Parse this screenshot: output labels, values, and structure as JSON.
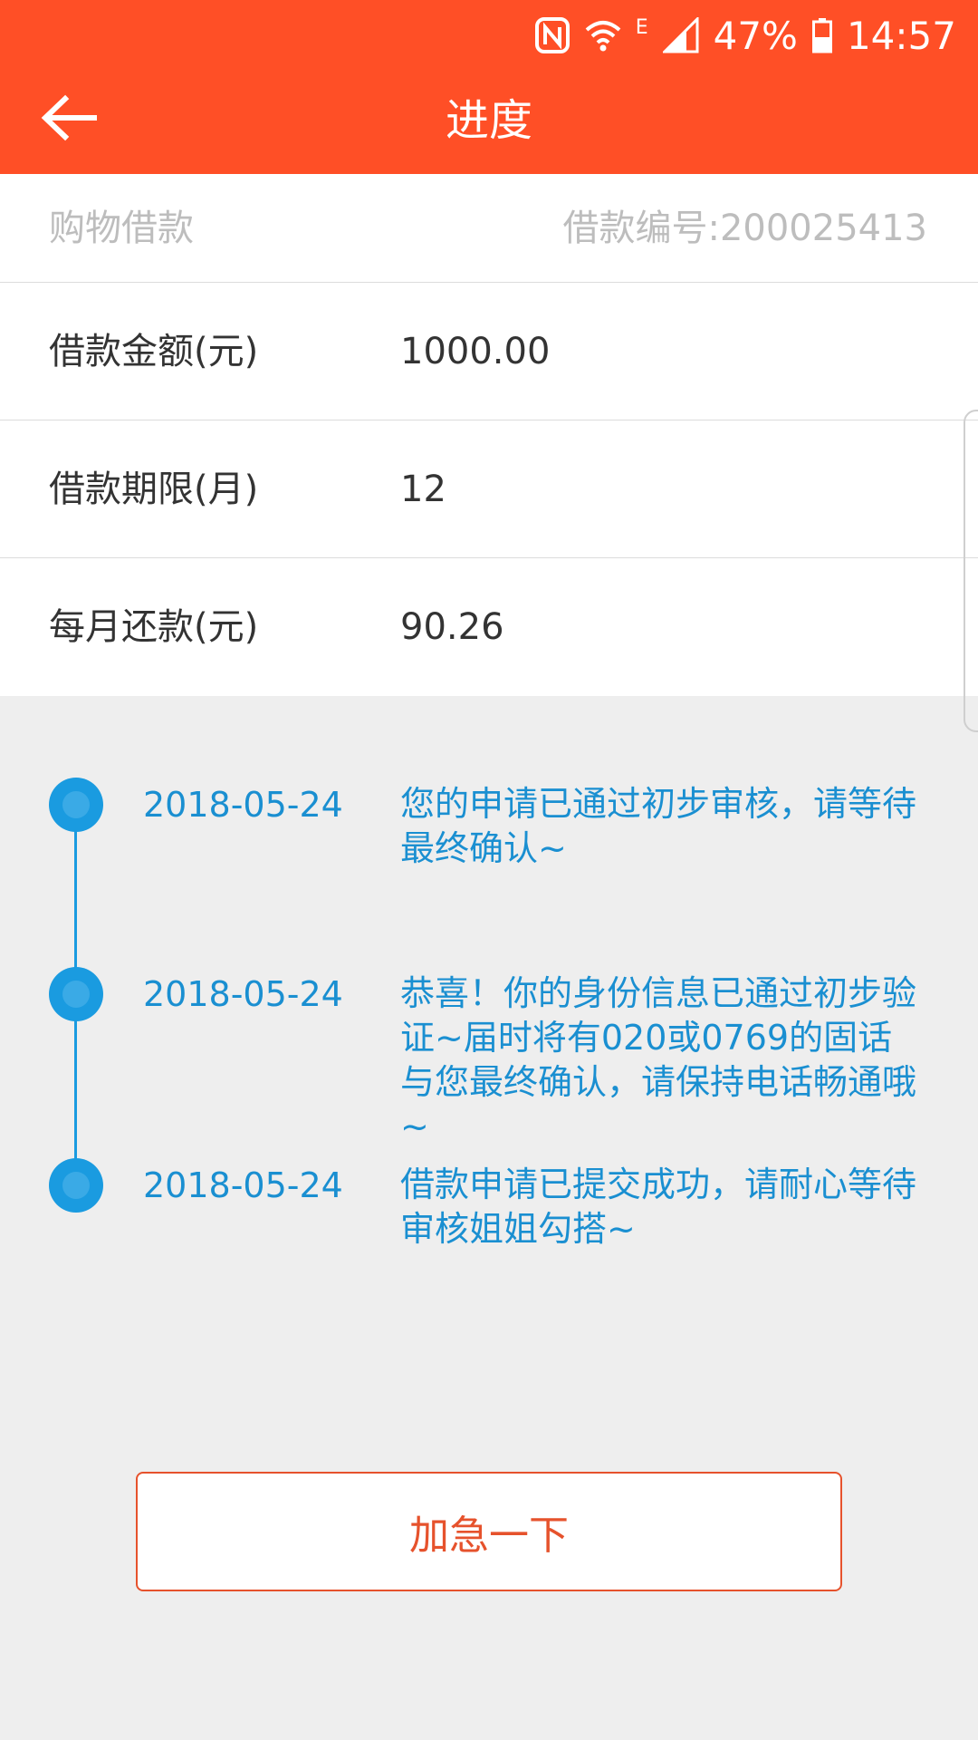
{
  "status_bar": {
    "battery": "47%",
    "time": "14:57",
    "network_type": "E",
    "icons": [
      "nfc-icon",
      "wifi-icon",
      "signal-icon",
      "battery-icon"
    ]
  },
  "header": {
    "title": "进度",
    "back_icon": "arrow-left-icon"
  },
  "loan": {
    "type": "购物借款",
    "number": "借款编号:200025413",
    "rows": [
      {
        "label": "借款金额(元)",
        "value": "1000.00"
      },
      {
        "label": "借款期限(月)",
        "value": "12"
      },
      {
        "label": "每月还款(元)",
        "value": "90.26"
      }
    ]
  },
  "timeline": [
    {
      "date": "2018-05-24",
      "text": "您的申请已通过初步审核，请等待最终确认~"
    },
    {
      "date": "2018-05-24",
      "text": "恭喜！你的身份信息已通过初步验证~届时将有020或0769的固话与您最终确认，请保持电话畅通哦~"
    },
    {
      "date": "2018-05-24",
      "text": "借款申请已提交成功，请耐心等待审核姐姐勾搭~"
    }
  ],
  "actions": {
    "urge_label": "加急一下"
  },
  "colors": {
    "appbar": "#ff4f26",
    "timeline": "#1a9be0",
    "button_border": "#e6522c"
  }
}
